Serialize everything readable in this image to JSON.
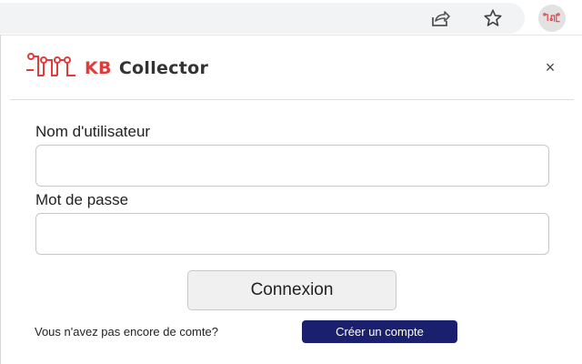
{
  "toolbar": {
    "share_icon": "share-icon",
    "star_icon": "bookmark-star-icon",
    "extension_icon": "kb-collector-extension-icon"
  },
  "brand": {
    "kb": "KB",
    "name": "Collector",
    "accent_color": "#e33b3b"
  },
  "form": {
    "username_label": "Nom d'utilisateur",
    "username_value": "",
    "password_label": "Mot de passe",
    "password_value": "",
    "login_label": "Connexion"
  },
  "signup": {
    "prompt": "Vous n'avez pas encore de comte?",
    "button_label": "Créer un compte",
    "button_color": "#1a1f6e"
  },
  "close_symbol": "×"
}
